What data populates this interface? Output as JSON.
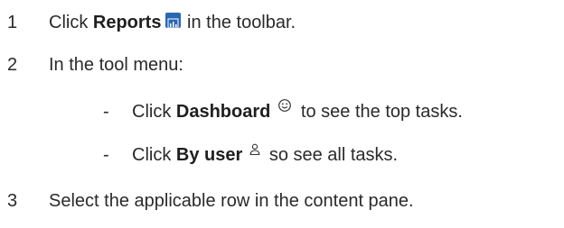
{
  "steps": [
    {
      "number": "1",
      "pre": "Click ",
      "bold": "Reports",
      "post": " in the toolbar.",
      "icon": "reports-chart-icon"
    },
    {
      "number": "2",
      "text": "In the tool menu:"
    },
    {
      "number": "3",
      "text": "Select the applicable row in the content pane."
    }
  ],
  "substeps": [
    {
      "dash": "-",
      "pre": "Click ",
      "bold": "Dashboard",
      "post": " to see the top tasks.",
      "icon": "dashboard-smiley-icon"
    },
    {
      "dash": "-",
      "pre": "Click ",
      "bold": "By user",
      "post": " so see all tasks.",
      "icon": "user-icon"
    }
  ],
  "colors": {
    "text": "#2a2a2a",
    "reports_icon_bg": "#2a67b3"
  }
}
